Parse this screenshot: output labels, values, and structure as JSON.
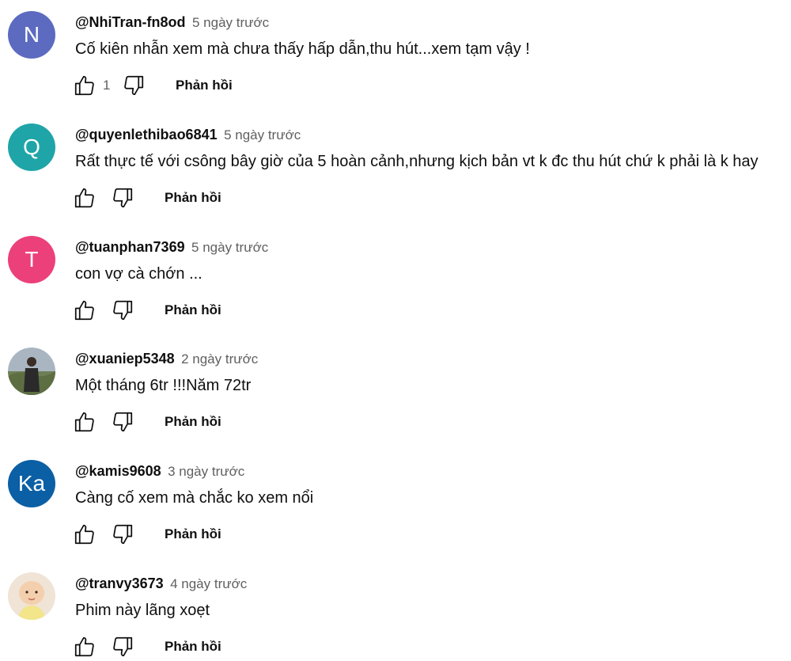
{
  "comments": [
    {
      "author": "@NhiTran-fn8od",
      "time": "5 ngày trước",
      "text": "Cố kiên nhẫn xem mà chưa thấy hấp dẫn,thu hút...xem tạm vậy !",
      "likes": "1",
      "avatar_letter": "N",
      "avatar_color": "#5c6bc0",
      "reply_label": "Phản hồi"
    },
    {
      "author": "@quyenlethibao6841",
      "time": "5 ngày trước",
      "text": "Rất thực tế với csông bây giờ của 5 hoàn cảnh,nhưng kịch bản vt k đc thu hút chứ k phải là k hay",
      "likes": "",
      "avatar_letter": "Q",
      "avatar_color": "#1fa5a8",
      "reply_label": "Phản hồi"
    },
    {
      "author": "@tuanphan7369",
      "time": "5 ngày trước",
      "text": "con vợ cà chớn ...",
      "likes": "",
      "avatar_letter": "T",
      "avatar_color": "#ec407a",
      "reply_label": "Phản hồi"
    },
    {
      "author": "@xuaniep5348",
      "time": "2 ngày trước",
      "text": "Một tháng 6tr !!!Năm 72tr",
      "likes": "",
      "avatar_letter": "",
      "avatar_color": "#7a8a6a",
      "reply_label": "Phản hồi"
    },
    {
      "author": "@kamis9608",
      "time": "3 ngày trước",
      "text": "Càng cố xem mà chắc ko xem nổi",
      "likes": "",
      "avatar_letter": "Ka",
      "avatar_color": "#0b5fa5",
      "reply_label": "Phản hồi"
    },
    {
      "author": "@tranvy3673",
      "time": "4 ngày trước",
      "text": "Phim này lãng xoẹt",
      "likes": "",
      "avatar_letter": "",
      "avatar_color": "#e8c8b0",
      "reply_label": "Phản hồi"
    }
  ]
}
